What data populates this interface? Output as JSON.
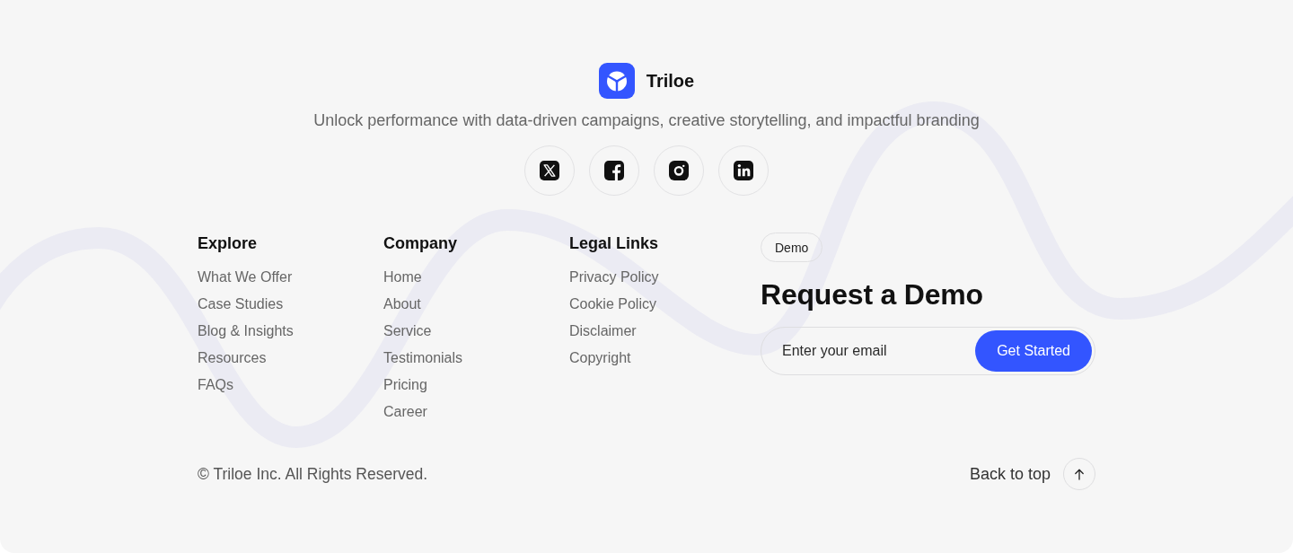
{
  "brand": {
    "name": "Triloe"
  },
  "tagline": "Unlock performance with data-driven campaigns, creative storytelling, and impactful branding",
  "link_columns": [
    {
      "heading": "Explore",
      "links": [
        "What We Offer",
        "Case Studies",
        "Blog & Insights",
        "Resources",
        "FAQs"
      ]
    },
    {
      "heading": "Company",
      "links": [
        "Home",
        "About",
        "Service",
        "Testimonials",
        "Pricing",
        "Career"
      ]
    },
    {
      "heading": "Legal Links",
      "links": [
        "Privacy Policy",
        "Cookie Policy",
        "Disclaimer",
        "Copyright"
      ]
    }
  ],
  "demo": {
    "tag": "Demo",
    "title": "Request a Demo",
    "email_field": {
      "placeholder": "Enter your email"
    },
    "button": "Get Started"
  },
  "bottom_bar": {
    "copyright": "© Triloe Inc. All Rights Reserved.",
    "back_to_top": "Back to top"
  }
}
